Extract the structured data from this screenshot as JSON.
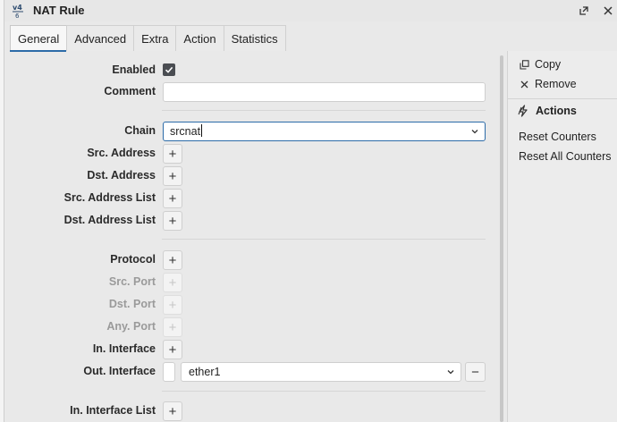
{
  "window": {
    "title": "NAT Rule",
    "icon_name": "nat-rule-icon",
    "restore_icon": "restore-window-icon",
    "close_icon": "close-icon"
  },
  "tabs": [
    {
      "label": "General",
      "active": true
    },
    {
      "label": "Advanced",
      "active": false
    },
    {
      "label": "Extra",
      "active": false
    },
    {
      "label": "Action",
      "active": false
    },
    {
      "label": "Statistics",
      "active": false
    }
  ],
  "form": {
    "enabled": {
      "label": "Enabled",
      "checked": true
    },
    "comment": {
      "label": "Comment",
      "value": ""
    },
    "chain": {
      "label": "Chain",
      "value": "srcnat"
    },
    "src_address": {
      "label": "Src. Address"
    },
    "dst_address": {
      "label": "Dst. Address"
    },
    "src_address_list": {
      "label": "Src. Address List"
    },
    "dst_address_list": {
      "label": "Dst. Address List"
    },
    "protocol": {
      "label": "Protocol"
    },
    "src_port": {
      "label": "Src. Port",
      "disabled": true
    },
    "dst_port": {
      "label": "Dst. Port",
      "disabled": true
    },
    "any_port": {
      "label": "Any. Port",
      "disabled": true
    },
    "in_interface": {
      "label": "In. Interface"
    },
    "out_interface": {
      "label": "Out. Interface",
      "value": "ether1"
    },
    "in_interface_list": {
      "label": "In. Interface List"
    },
    "add_symbol": "+",
    "remove_symbol": "−"
  },
  "side_panel": {
    "copy_label": "Copy",
    "remove_label": "Remove",
    "actions_heading": "Actions",
    "reset_counters_label": "Reset Counters",
    "reset_all_counters_label": "Reset All Counters"
  },
  "colors": {
    "accent": "#2c6ba8",
    "checkbox": "#4a4d52"
  }
}
